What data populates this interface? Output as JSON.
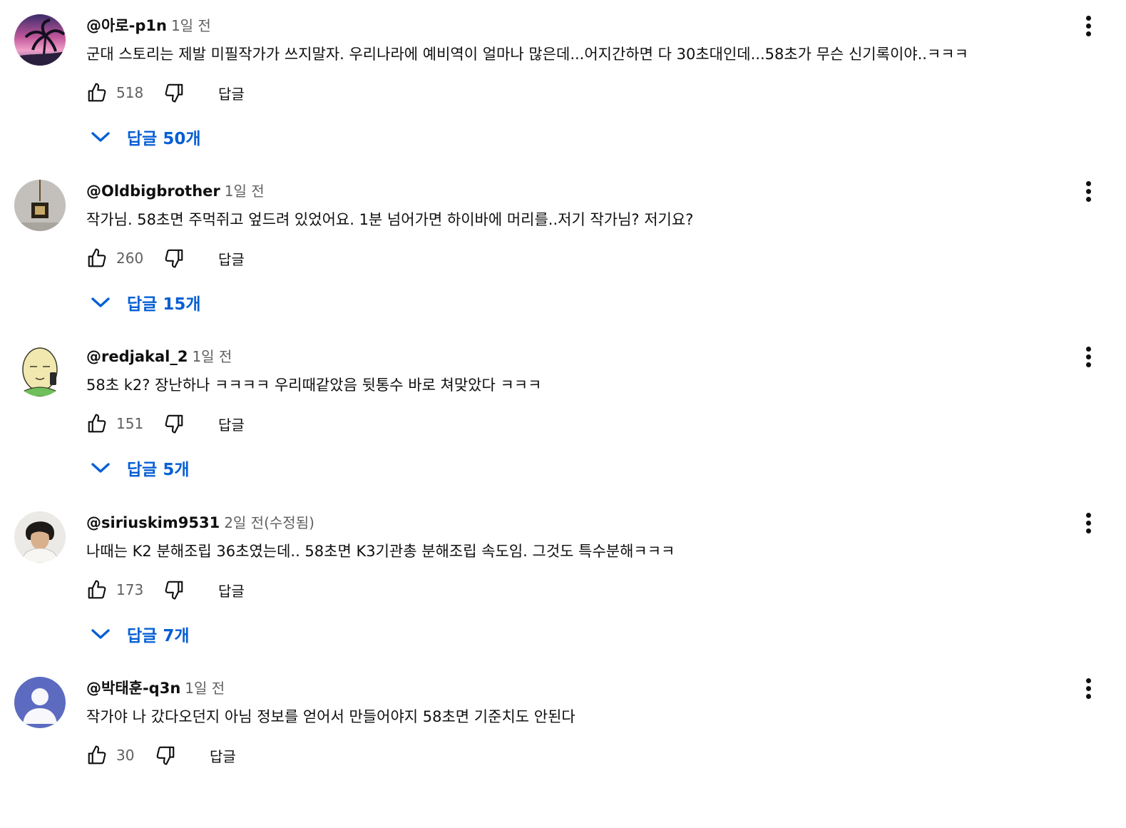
{
  "comments": [
    {
      "author": "@아로-p1n",
      "time": "1일 전",
      "text": "군대 스토리는 제발 미필작가가 쓰지말자. 우리나라에  예비역이 얼마나 많은데...어지간하면 다 30초대인데...58초가 무슨 신기록이야..ㅋㅋㅋ",
      "likes": "518",
      "reply_label": "답글",
      "replies": "답글 50개"
    },
    {
      "author": "@Oldbigbrother",
      "time": "1일 전",
      "text": "작가님. 58초면 주먹쥐고 엎드려 있었어요. 1분 넘어가면 하이바에 머리를..저기 작가님? 저기요?",
      "likes": "260",
      "reply_label": "답글",
      "replies": "답글 15개"
    },
    {
      "author": "@redjakal_2",
      "time": "1일 전",
      "text": "58초 k2? 장난하나 ㅋㅋㅋㅋ 우리때같았음 뒷통수 바로 쳐맞았다 ㅋㅋㅋ",
      "likes": "151",
      "reply_label": "답글",
      "replies": "답글 5개"
    },
    {
      "author": "@siriuskim9531",
      "time": "2일 전(수정됨)",
      "text": "나때는 K2 분해조립 36초였는데.. 58초면 K3기관총 분해조립 속도임. 그것도 특수분해ㅋㅋㅋ",
      "likes": "173",
      "reply_label": "답글",
      "replies": "답글 7개"
    },
    {
      "author": "@박태훈-q3n",
      "time": "1일 전",
      "text": "작가야 나 갔다오던지 아님 정보를 얻어서 만들어야지 58초면 기준치도 안된다",
      "likes": "30",
      "reply_label": "답글"
    }
  ],
  "icons": {
    "like": "thumbs-up-outline-icon",
    "dislike": "thumbs-down-outline-icon",
    "expand": "chevron-down-icon",
    "menu": "more-vertical-icon"
  },
  "colors": {
    "link": "#065fd4",
    "secondary_text": "#606060",
    "primary_text": "#0f0f0f",
    "default_avatar": "#5c6bc0"
  }
}
